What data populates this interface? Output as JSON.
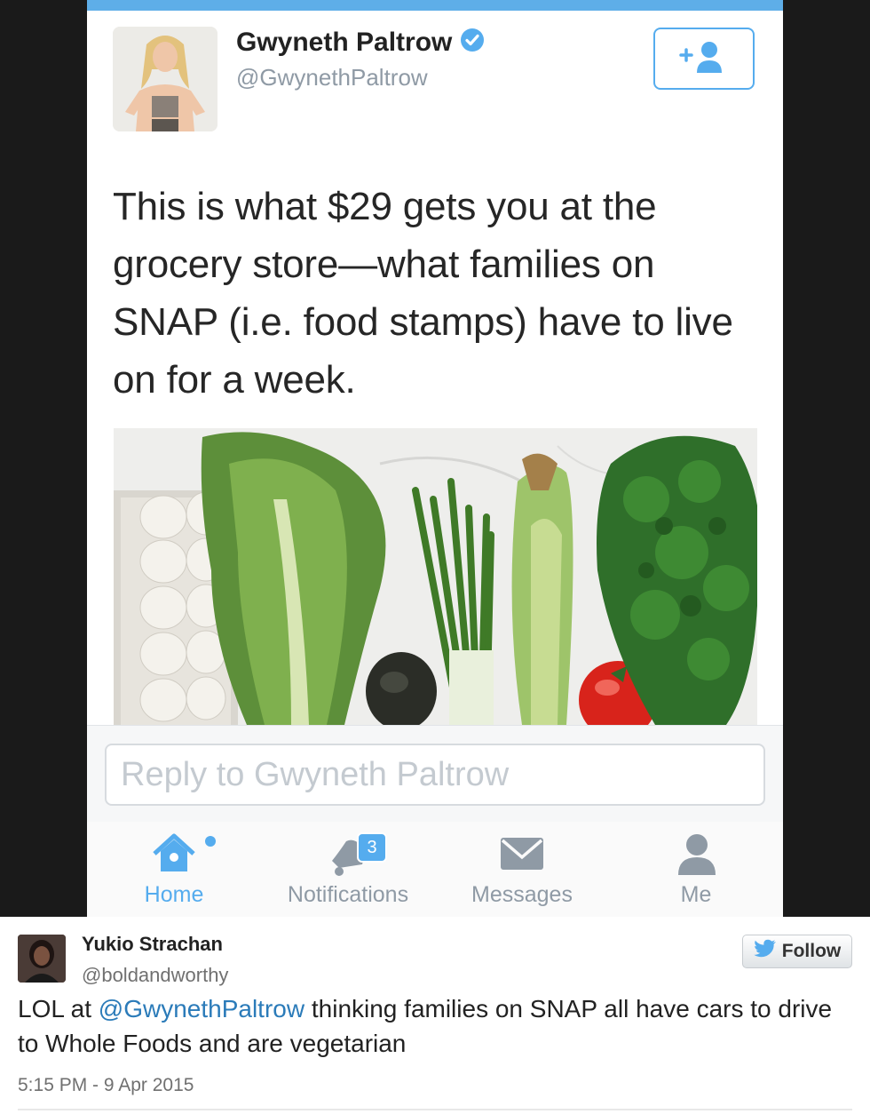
{
  "tweet": {
    "name": "Gwyneth Paltrow",
    "handle": "@GwynethPaltrow",
    "text": "This is what $29 gets you at the grocery store—what families on SNAP (i.e. food stamps) have to live on for a week."
  },
  "reply": {
    "placeholder": "Reply to Gwyneth Paltrow"
  },
  "tabs": {
    "home": "Home",
    "notifications": "Notifications",
    "notifications_badge": "3",
    "messages": "Messages",
    "me": "Me"
  },
  "embed": {
    "name": "Yukio Strachan",
    "handle": "@boldandworthy",
    "follow_label": "Follow",
    "text_prefix": "LOL at ",
    "mention": "@GwynethPaltrow",
    "text_suffix": " thinking families on SNAP all have cars to drive to Whole Foods and are vegetarian",
    "timestamp": "5:15 PM - 9 Apr 2015"
  },
  "colors": {
    "accent": "#55acee",
    "link": "#2b7bb9",
    "top_bar": "#5eaee8"
  },
  "icons": [
    "verified-badge-icon",
    "add-user-icon",
    "home-icon",
    "bell-icon",
    "envelope-icon",
    "person-icon",
    "twitter-bird-icon"
  ]
}
